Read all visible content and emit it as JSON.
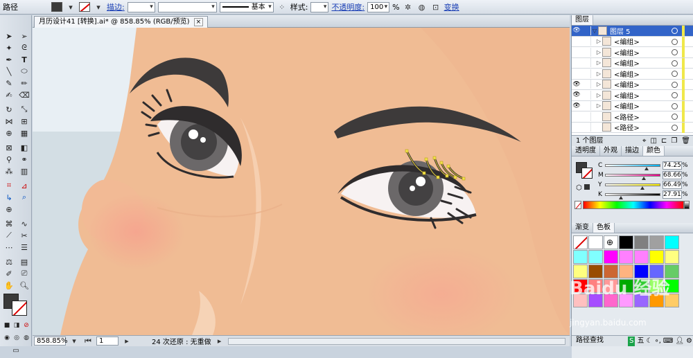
{
  "control_bar": {
    "object_type": "路径",
    "stroke_label": "描边:",
    "style_label": "样式:",
    "brush_name": "基本",
    "opacity_label": "不透明度:",
    "opacity_value": "100",
    "opacity_unit": "%",
    "transform_label": "变换",
    "fill_color": "#3a3a3a"
  },
  "document": {
    "tab_title": "月历设计41 [转换].ai* @ 858.85% (RGB/预览)",
    "close": "×"
  },
  "status_bar": {
    "zoom": "858.85%",
    "artboard": "1",
    "history": "24 次还原 : 无重做"
  },
  "layers_panel": {
    "title": "图层",
    "rows": [
      {
        "name": "图层 5",
        "selected": true,
        "arrow": "▽"
      },
      {
        "name": "<编组>",
        "arrow": "▷"
      },
      {
        "name": "<编组>",
        "arrow": "▷"
      },
      {
        "name": "<编组>",
        "arrow": "▷"
      },
      {
        "name": "<编组>",
        "arrow": "▷"
      },
      {
        "name": "<编组>",
        "arrow": "▷"
      },
      {
        "name": "<编组>",
        "arrow": "▷"
      },
      {
        "name": "<编组>",
        "arrow": "▷"
      },
      {
        "name": "<路径>",
        "arrow": ""
      },
      {
        "name": "<路径>",
        "arrow": ""
      }
    ],
    "footer": "1 个图层"
  },
  "color_panel": {
    "tabs": [
      "透明度",
      "外观",
      "描边",
      "颜色"
    ],
    "channels": [
      {
        "name": "C",
        "value": "74.25",
        "unit": "%",
        "level": 0.7425
      },
      {
        "name": "M",
        "value": "68.66",
        "unit": "%",
        "level": 0.6866
      },
      {
        "name": "Y",
        "value": "66.49",
        "unit": "%",
        "level": 0.6649
      },
      {
        "name": "K",
        "value": "27.91",
        "unit": "%",
        "level": 0.2791
      }
    ]
  },
  "swatches_panel": {
    "tabs": [
      "渐变",
      "色板"
    ],
    "colors": [
      "none",
      "#ffffff",
      "#ffffff",
      "#000000",
      "#808080",
      "#a0a0a0",
      "#00ffff",
      "#80ffff",
      "#80ffff",
      "#ff00ff",
      "#ff80ff",
      "#ff80ff",
      "#ffff00",
      "#ffff80",
      "#ffff80",
      "#994c00",
      "#cc6633",
      "#ffb380",
      "#0000ff",
      "#6666ff",
      "#66cc66",
      "#ff0000",
      "#ff8080",
      "#ff9999",
      "#00aa00",
      "#33cc33",
      "#99ff66",
      "#00ff00",
      "#ffc0c0",
      "#a64dff",
      "#ff66cc",
      "#ff99ff",
      "#9966ff",
      "#ff9900",
      "#ffcc66"
    ],
    "footer": "路径查找"
  },
  "tray": {
    "ime": "五"
  },
  "watermark": {
    "text": "Baidu 经验",
    "sub": "jingyan.baidu.com"
  },
  "colors": {
    "skin": "#f1bc94",
    "brow": "#3d3a3a",
    "iris": "#6b6869",
    "blush": "#f4a894"
  }
}
